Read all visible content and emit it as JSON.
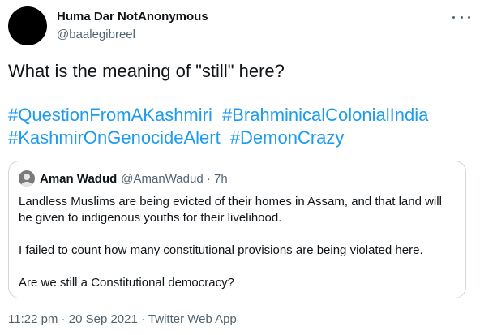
{
  "tweet": {
    "display_name": "Huma Dar NotAnonymous",
    "handle": "@baalegibreel",
    "more_icon": "more-horizontal-icon",
    "text": "What is the meaning of \"still\" here?",
    "hashtags": [
      "#QuestionFromAKashmiri",
      "#BrahminicalColonialIndia",
      "#KashmirOnGenocideAlert",
      "#DemonCrazy"
    ],
    "link_color": "#1d9bf0",
    "timestamp": "11:22 pm · 20 Sep 2021 · Twitter Web App"
  },
  "quoted": {
    "display_name": "Aman Wadud",
    "handle_time": "@AmanWadud · 7h",
    "paragraphs": [
      "Landless Muslims are being evicted of their homes in Assam, and that land will be given to indigenous youths for their livelihood.",
      "I failed to count how many constitutional provisions are being violated here.",
      "Are we still a Constitutional democracy?"
    ]
  }
}
